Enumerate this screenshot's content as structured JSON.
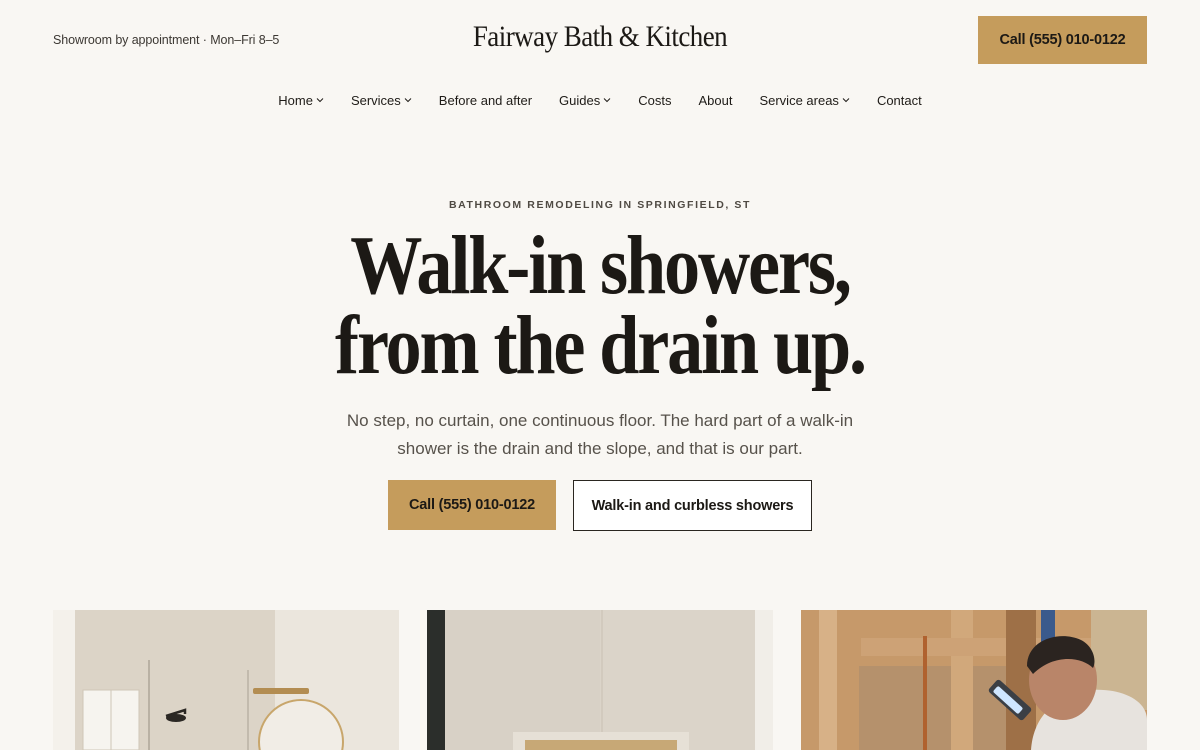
{
  "header": {
    "hours": "Showroom by appointment · Mon–Fri 8–5",
    "brand": "Fairway Bath & Kitchen",
    "call_label": "Call (555) 010-0122"
  },
  "nav": {
    "items": [
      {
        "label": "Home",
        "has_dropdown": true
      },
      {
        "label": "Services",
        "has_dropdown": true
      },
      {
        "label": "Before and after",
        "has_dropdown": false
      },
      {
        "label": "Guides",
        "has_dropdown": true
      },
      {
        "label": "Costs",
        "has_dropdown": false
      },
      {
        "label": "About",
        "has_dropdown": false
      },
      {
        "label": "Service areas",
        "has_dropdown": true
      },
      {
        "label": "Contact",
        "has_dropdown": false
      }
    ]
  },
  "hero": {
    "eyebrow": "BATHROOM REMODELING IN SPRINGFIELD, ST",
    "headline_line1": "Walk-in showers,",
    "headline_line2": "from the drain up.",
    "lede": "No step, no curtain, one continuous floor. The hard part of a walk-in shower is the drain and the slope, and that is our part.",
    "cta_primary": "Call (555) 010-0122",
    "cta_secondary": "Walk-in and curbless showers"
  },
  "gallery": {
    "photos": [
      "bathroom-vanity-photo",
      "shower-niche-photo",
      "contractor-inspecting-photo"
    ]
  },
  "colors": {
    "accent": "#c59c5c",
    "background": "#f9f7f3",
    "text": "#1c1915"
  }
}
